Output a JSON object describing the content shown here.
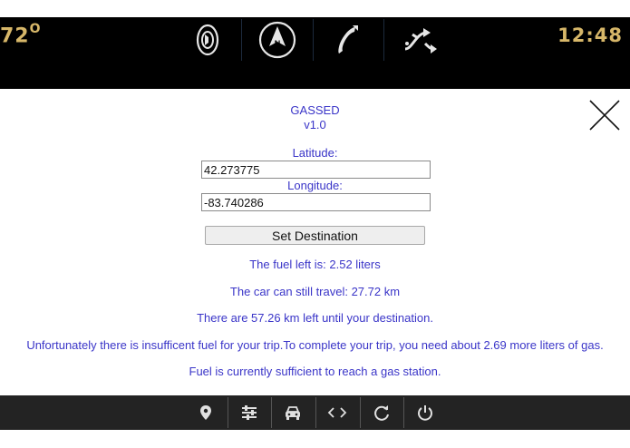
{
  "status_bar": {
    "temperature": "72",
    "degree": "O",
    "time": "12:48",
    "icons": [
      "speaker-icon",
      "compass-icon",
      "phone-icon",
      "shuffle-icon"
    ]
  },
  "app": {
    "name": "GASSED",
    "version": "v1.0"
  },
  "form": {
    "latitude_label": "Latitude:",
    "latitude_value": "42.273775",
    "longitude_label": "Longitude:",
    "longitude_value": "-83.740286",
    "submit_label": "Set Destination"
  },
  "results": {
    "fuel_left": "The fuel left is: 2.52 liters",
    "can_travel": "The car can still travel: 27.72 km",
    "distance_left": "There are 57.26 km left until your destination.",
    "insufficient": "Unfortunately there is insufficent fuel for your trip.To complete your trip, you need about 2.69 more liters of gas.",
    "gas_station": "Fuel is currently sufficient to reach a gas station."
  },
  "bottom_bar": {
    "icons": [
      "location-pin-icon",
      "sliders-icon",
      "car-icon",
      "code-icon",
      "refresh-icon",
      "power-icon"
    ]
  },
  "colors": {
    "accent_text": "#3a35c8",
    "status_text": "#d7b769",
    "top_bar": "#000000",
    "bottom_bar": "#232323"
  }
}
